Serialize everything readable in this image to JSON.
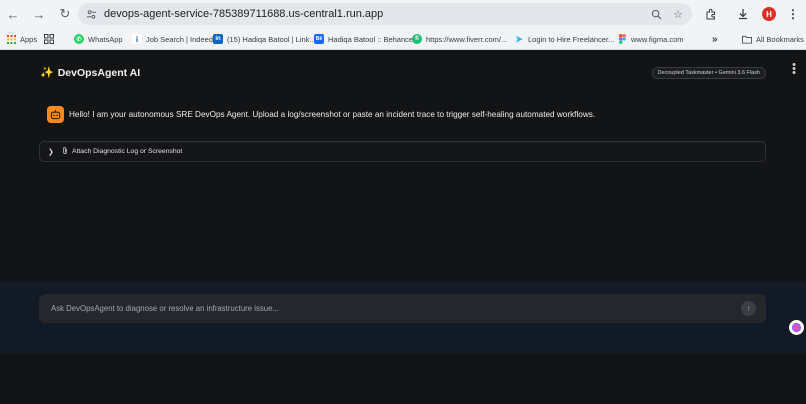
{
  "browser": {
    "url": "devops-agent-service-785389711688.us-central1.run.app",
    "profile_initial": "H"
  },
  "bookmarks": [
    {
      "label": "Apps",
      "icon": "apps-grid-icon"
    },
    {
      "label": "",
      "icon": "grid-icon"
    },
    {
      "label": "WhatsApp",
      "icon": "whatsapp-icon",
      "color": "#25d366"
    },
    {
      "label": "Job Search | Indeed",
      "icon": "indeed-icon",
      "color": "#2557a7"
    },
    {
      "label": "(15) Hadiqa Batool | Link...",
      "icon": "linkedin-icon",
      "color": "#0a66c2"
    },
    {
      "label": "Hadiqa Batool :: Behance",
      "icon": "behance-icon",
      "color": "#1769ff"
    },
    {
      "label": "https://www.fiverr.com/...",
      "icon": "fiverr-icon",
      "color": "#1dbf73"
    },
    {
      "label": "Login to Hire Freelancer...",
      "icon": "freelancer-icon",
      "color": "#29b2fe"
    },
    {
      "label": "www.figma.com",
      "icon": "figma-icon",
      "color": "#f24e1e"
    },
    {
      "label": "All Bookmarks",
      "icon": "folder-icon"
    }
  ],
  "app": {
    "title": "DevOpsAgent AI",
    "model_badge": "Decoupled Taskmaster • Gemini 3.6 Flash",
    "greeting": "Hello! I am your autonomous SRE DevOps Agent. Upload a log/screenshot or paste an incident trace to trigger self-healing automated workflows.",
    "attach_label": "Attach Diagnostic Log or Screenshot",
    "input_placeholder": "Ask DevOpsAgent to diagnose or resolve an infrastructure issue...",
    "accent_color": "#ff8a1c"
  }
}
